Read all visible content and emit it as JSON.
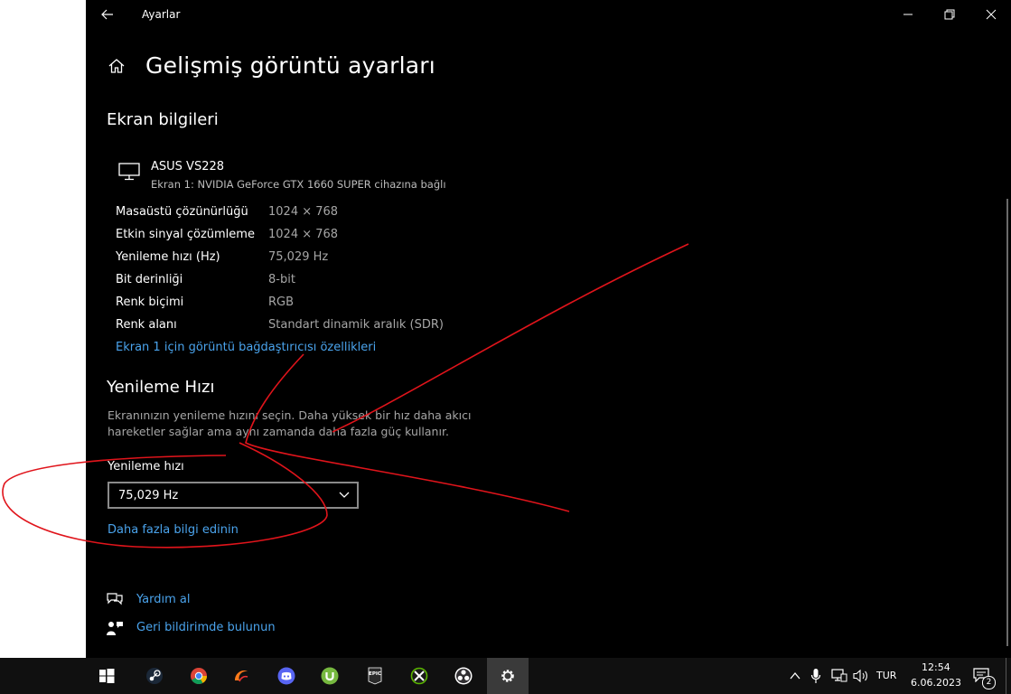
{
  "window": {
    "app_title": "Ayarlar",
    "page_title": "Gelişmiş görüntü ayarları"
  },
  "display_info": {
    "heading": "Ekran bilgileri",
    "monitor_name": "ASUS VS228",
    "monitor_sub": "Ekran 1: NVIDIA GeForce GTX 1660 SUPER cihazına bağlı",
    "rows": [
      {
        "label": "Masaüstü çözünürlüğü",
        "value": "1024 × 768"
      },
      {
        "label": "Etkin sinyal çözümleme",
        "value": "1024 × 768"
      },
      {
        "label": "Yenileme hızı (Hz)",
        "value": "75,029 Hz"
      },
      {
        "label": "Bit derinliği",
        "value": "8-bit"
      },
      {
        "label": "Renk biçimi",
        "value": "RGB"
      },
      {
        "label": "Renk alanı",
        "value": "Standart dinamik aralık (SDR)"
      }
    ],
    "adapter_link": "Ekran 1 için görüntü bağdaştırıcısı özellikleri"
  },
  "refresh": {
    "heading": "Yenileme Hızı",
    "desc_line1": "Ekranınızın yenileme hızını seçin. Daha yüksek bir hız daha akıcı",
    "desc_line2": "hareketler sağlar ama aynı zamanda daha fazla güç kullanır.",
    "dropdown_label": "Yenileme hızı",
    "dropdown_value": "75,029 Hz",
    "learn_more": "Daha fazla bilgi edinin"
  },
  "footer": {
    "help": "Yardım al",
    "feedback": "Geri bildirimde bulunun"
  },
  "taskbar": {
    "apps": [
      "windows-start",
      "steam",
      "chrome",
      "uplay",
      "discord",
      "utorrent",
      "epic-games",
      "xbox-app",
      "obs",
      "settings"
    ],
    "language": "TUR",
    "time": "12:54",
    "date": "6.06.2023",
    "notification_count": "2"
  },
  "colors": {
    "background": "#000000",
    "link": "#4aa3ec",
    "secondary_text": "#a6a6a6",
    "annotation": "#e0141b",
    "taskbar": "#101010"
  }
}
